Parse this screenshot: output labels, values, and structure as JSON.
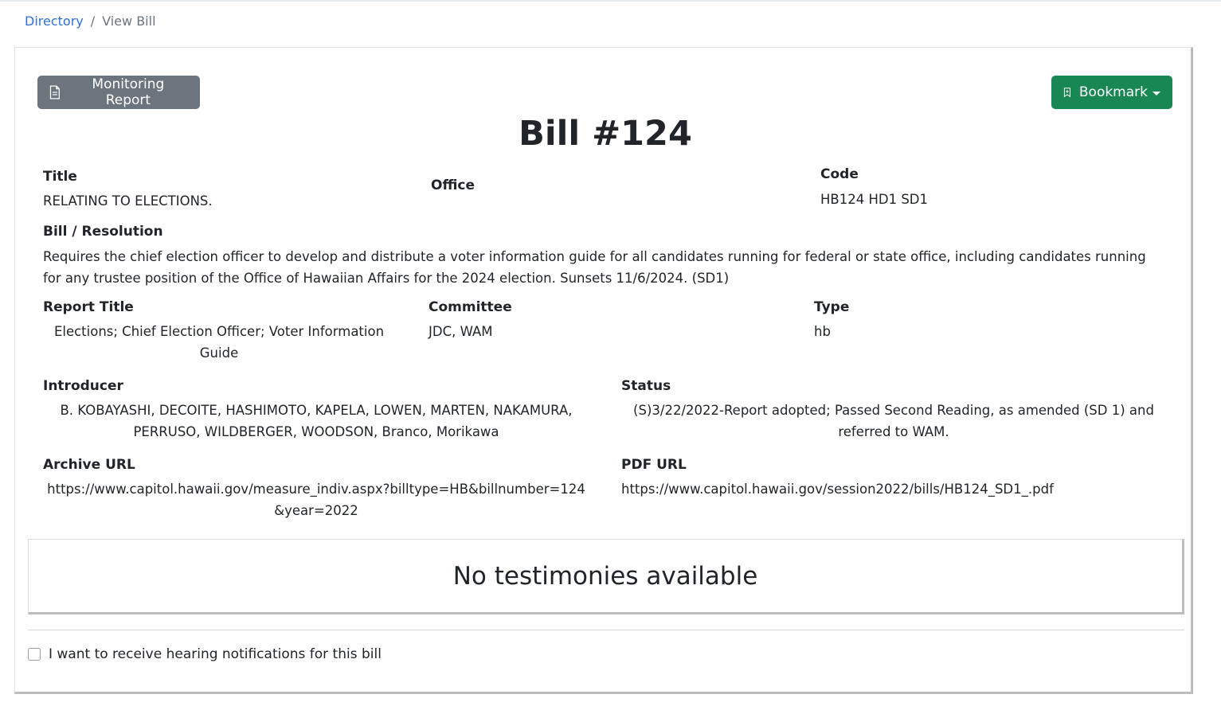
{
  "breadcrumb": {
    "root": "Directory",
    "separator": "/",
    "current": "View Bill"
  },
  "actions": {
    "monitoring_report": "Monitoring Report",
    "bookmark": "Bookmark"
  },
  "bill": {
    "heading": "Bill #124",
    "title_label": "Title",
    "title_value": "RELATING TO ELECTIONS.",
    "office_label": "Office",
    "code_label": "Code",
    "code_value": "HB124 HD1 SD1",
    "resolution_label": "Bill / Resolution",
    "resolution_value": "Requires the chief election officer to develop and distribute a voter information guide for all candidates running for federal or state office, including candidates running for any trustee position of the Office of Hawaiian Affairs for the 2024 election. Sunsets 11/6/2024. (SD1)",
    "report_title_label": "Report Title",
    "report_title_value": "Elections; Chief Election Officer; Voter Information Guide",
    "committee_label": "Committee",
    "committee_value": "JDC, WAM",
    "type_label": "Type",
    "type_value": "hb",
    "introducer_label": "Introducer",
    "introducer_value": "B. KOBAYASHI, DECOITE, HASHIMOTO, KAPELA, LOWEN, MARTEN, NAKAMURA, PERRUSO, WILDBERGER, WOODSON, Branco, Morikawa",
    "status_label": "Status",
    "status_value": "(S)3/22/2022-Report adopted; Passed Second Reading, as amended (SD 1) and referred to WAM.",
    "archive_url_label": "Archive URL",
    "archive_url_value": "https://www.capitol.hawaii.gov/measure_indiv.aspx?billtype=HB&billnumber=124&year=2022",
    "pdf_url_label": "PDF URL",
    "pdf_url_value": "https://www.capitol.hawaii.gov/session2022/bills/HB124_SD1_.pdf"
  },
  "testimonies": {
    "empty_message": "No testimonies available"
  },
  "notifications": {
    "checkbox_label": "I want to receive hearing notifications for this bill",
    "checked": false
  },
  "colors": {
    "link": "#2f6fd6",
    "secondary_button": "#6c757d",
    "success_button": "#198754"
  }
}
